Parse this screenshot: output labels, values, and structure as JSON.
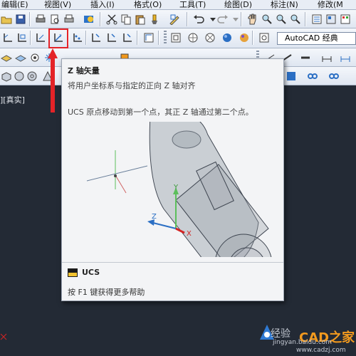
{
  "menubar": {
    "items": [
      {
        "label": "编辑(E)"
      },
      {
        "label": "视图(V)"
      },
      {
        "label": "插入(I)"
      },
      {
        "label": "格式(O)"
      },
      {
        "label": "工具(T)"
      },
      {
        "label": "绘图(D)"
      },
      {
        "label": "标注(N)"
      },
      {
        "label": "修改(M"
      }
    ]
  },
  "toolbar": {
    "workspace_select": "AutoCAD 经典"
  },
  "viewport": {
    "label": "][真实]"
  },
  "tooltip": {
    "title": "Z 轴矢量",
    "description": "将用户坐标系与指定的正向 Z 轴对齐",
    "detail": "UCS 原点移动到第一个点，其正 Z 轴通过第二个点。",
    "command": "UCS",
    "help": "按 F1 键获得更多帮助",
    "illustration_axes": {
      "x": "X",
      "y": "Y",
      "z": "Z"
    }
  },
  "watermark": {
    "baidu": "经验",
    "brand": "CAD之家",
    "url": "jingyan.baidu.com",
    "url2": "www.cadzj.com"
  },
  "colors": {
    "viewport_bg": "#232a35",
    "annotation_red": "#e42328",
    "tooltip_bg": "#f3f4f6",
    "watermark_orange": "#f39a1e"
  }
}
